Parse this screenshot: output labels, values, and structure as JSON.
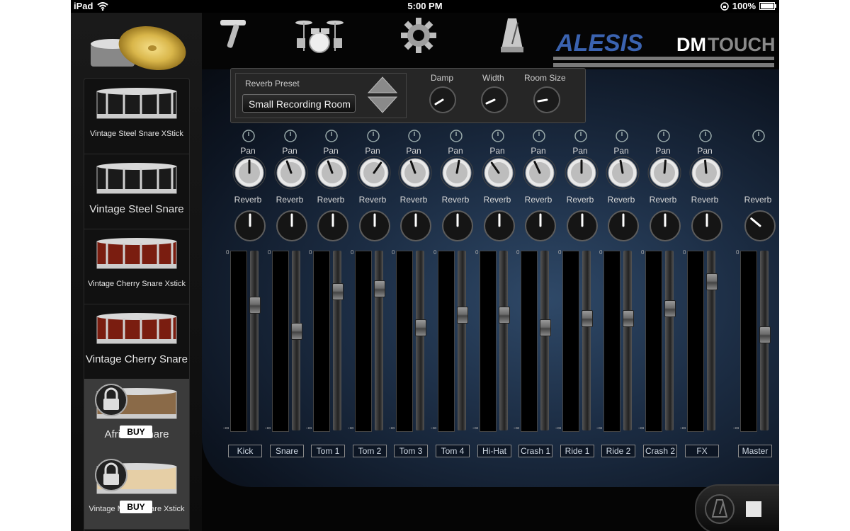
{
  "status": {
    "device": "iPad",
    "time": "5:00 PM",
    "battery": "100%"
  },
  "kits": [
    {
      "label": "Vintage Steel Snare XStick",
      "color": "#1a1a1a",
      "locked": false
    },
    {
      "label": "Vintage Steel Snare",
      "color": "#1a1a1a",
      "locked": false
    },
    {
      "label": "Vintage Cherry Snare Xstick",
      "color": "#7a1d10",
      "locked": false
    },
    {
      "label": "Vintage Cherry Snare",
      "color": "#7a1d10",
      "locked": false
    },
    {
      "label": "African Snare",
      "color": "#8a6a48",
      "locked": true,
      "buy": "BUY"
    },
    {
      "label": "Vintage Maple Snare Xstick",
      "color": "#e6cfa6",
      "locked": true,
      "buy": "BUY"
    }
  ],
  "toolbar": {
    "icons": [
      "drum-key-icon",
      "drum-kit-icon",
      "gear-icon",
      "metronome-icon"
    ]
  },
  "logo": {
    "brand": "ALESIS",
    "product_a": "DM",
    "product_b": "TOUCH"
  },
  "reverb": {
    "preset_label": "Reverb Preset",
    "preset_value": "Small Recording Room",
    "damp_label": "Damp",
    "width_label": "Width",
    "room_size_label": "Room Size"
  },
  "mixer": {
    "pan_label": "Pan",
    "reverb_label": "Reverb",
    "scale_top": "0",
    "scale_bottom": "-∞",
    "channels": [
      {
        "name": "Kick",
        "fader": 0.72
      },
      {
        "name": "Snare",
        "fader": 0.56
      },
      {
        "name": "Tom 1",
        "fader": 0.8
      },
      {
        "name": "Tom 2",
        "fader": 0.82
      },
      {
        "name": "Tom 3",
        "fader": 0.58
      },
      {
        "name": "Tom 4",
        "fader": 0.66
      },
      {
        "name": "Hi-Hat",
        "fader": 0.66
      },
      {
        "name": "Crash 1",
        "fader": 0.58
      },
      {
        "name": "Ride 1",
        "fader": 0.64
      },
      {
        "name": "Ride 2",
        "fader": 0.64
      },
      {
        "name": "Crash 2",
        "fader": 0.7
      },
      {
        "name": "FX",
        "fader": 0.86
      }
    ],
    "master": {
      "name": "Master",
      "fader": 0.54,
      "reverb_label": "Reverb"
    }
  }
}
